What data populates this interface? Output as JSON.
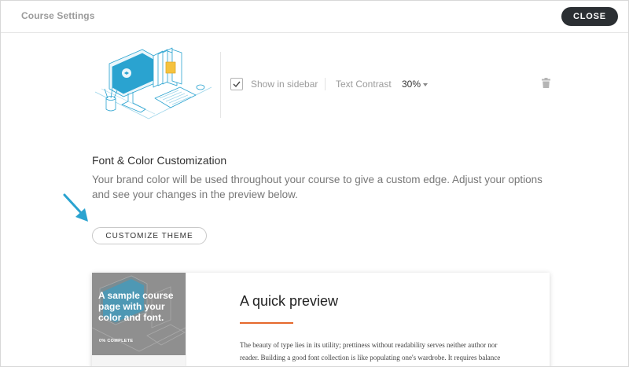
{
  "header": {
    "title": "Course Settings",
    "close_label": "CLOSE"
  },
  "sidebar_options": {
    "show_in_sidebar_label": "Show in sidebar",
    "show_in_sidebar_checked": true,
    "text_contrast_label": "Text Contrast",
    "text_contrast_value": "30%"
  },
  "customization": {
    "title": "Font & Color Customization",
    "description": "Your brand color will be used throughout your course to give a custom edge. Adjust your options and see your changes in the preview below.",
    "button_label": "CUSTOMIZE THEME"
  },
  "preview": {
    "card_text": "A sample course page with your color and font.",
    "progress_text": "0% COMPLETE",
    "heading": "A quick preview",
    "body": "The beauty of type lies in its utility; prettiness without readability serves neither author nor reader. Building a good font collection is like populating one's wardrobe. It requires balance between versatility and expressivity."
  },
  "colors": {
    "accent": "#e5682c",
    "close_button_bg": "#2b2f33",
    "illustration": "#2aa3d0",
    "arrow": "#2aa3d0"
  },
  "icons": [
    "check-icon",
    "caret-down-icon",
    "trash-icon",
    "arrow-icon"
  ]
}
